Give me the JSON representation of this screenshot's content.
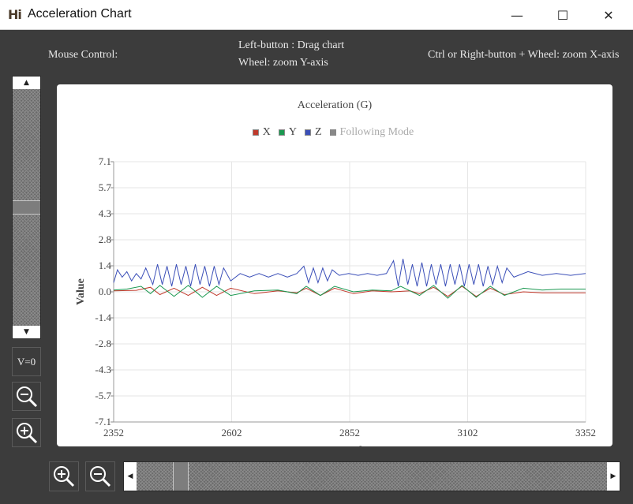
{
  "window": {
    "logo": "Hi",
    "title": "Acceleration Chart",
    "min_glyph": "—",
    "max_glyph": "☐",
    "close_glyph": "✕"
  },
  "mouse_control": {
    "label": "Mouse Control:",
    "left_button": "Left-button : Drag chart",
    "wheel": "Wheel: zoom Y-axis",
    "ctrl_wheel": "Ctrl or Right-button + Wheel: zoom X-axis"
  },
  "controls": {
    "v0_label": "V=0",
    "zoom_out_icon": "zoom-out-icon",
    "zoom_in_icon": "zoom-in-icon",
    "up_arrow": "▲",
    "down_arrow": "▼",
    "left_arrow": "◀",
    "right_arrow": "▶",
    "v_scroll_position": 0.5,
    "h_scroll_position": 0.08
  },
  "legend": [
    {
      "label": "X",
      "color": "#c0392b"
    },
    {
      "label": "Y",
      "color": "#1a9850"
    },
    {
      "label": "Z",
      "color": "#3b4fb8"
    },
    {
      "label": "Following Mode",
      "color": "#888888",
      "muted": true
    }
  ],
  "chart_data": {
    "type": "line",
    "title": "Acceleration (G)",
    "xlabel": "Sample",
    "ylabel": "Value",
    "xlim": [
      2352,
      3352
    ],
    "ylim": [
      -7.1,
      7.1
    ],
    "x_ticks": [
      "2352",
      "2602",
      "2852",
      "3102",
      "3352"
    ],
    "y_ticks": [
      "7.1",
      "5.7",
      "4.3",
      "2.8",
      "1.4",
      "0.0",
      "-1.4",
      "-2.8",
      "-4.3",
      "-5.7",
      "-7.1"
    ],
    "grid": true,
    "series": [
      {
        "name": "X",
        "color": "#c0392b",
        "x": [
          2352,
          2400,
          2430,
          2450,
          2480,
          2510,
          2540,
          2570,
          2600,
          2650,
          2700,
          2740,
          2760,
          2790,
          2820,
          2860,
          2900,
          2940,
          2980,
          3000,
          3030,
          3060,
          3090,
          3120,
          3150,
          3180,
          3220,
          3260,
          3300,
          3352
        ],
        "y": [
          0.05,
          0.08,
          0.25,
          -0.15,
          0.2,
          -0.2,
          0.25,
          -0.2,
          0.2,
          -0.1,
          0.05,
          -0.05,
          0.2,
          -0.2,
          0.2,
          -0.1,
          0.05,
          0.0,
          0.05,
          -0.1,
          0.25,
          -0.25,
          0.3,
          -0.25,
          0.2,
          -0.15,
          0.0,
          -0.05,
          -0.05,
          -0.05
        ]
      },
      {
        "name": "Y",
        "color": "#1a9850",
        "x": [
          2352,
          2380,
          2410,
          2430,
          2450,
          2480,
          2510,
          2540,
          2570,
          2600,
          2650,
          2700,
          2740,
          2760,
          2790,
          2820,
          2860,
          2900,
          2940,
          2960,
          3000,
          3030,
          3060,
          3090,
          3120,
          3150,
          3180,
          3220,
          3260,
          3300,
          3352
        ],
        "y": [
          0.1,
          0.15,
          0.3,
          -0.1,
          0.35,
          -0.25,
          0.35,
          -0.3,
          0.3,
          -0.2,
          0.05,
          0.1,
          -0.1,
          0.3,
          -0.2,
          0.3,
          0.0,
          0.1,
          0.05,
          0.3,
          -0.2,
          0.35,
          -0.35,
          0.35,
          -0.3,
          0.3,
          -0.2,
          0.2,
          0.1,
          0.15,
          0.15
        ]
      },
      {
        "name": "Z",
        "color": "#3b4fb8",
        "x": [
          2352,
          2360,
          2370,
          2380,
          2390,
          2400,
          2410,
          2420,
          2435,
          2445,
          2455,
          2465,
          2475,
          2485,
          2495,
          2505,
          2515,
          2525,
          2535,
          2545,
          2555,
          2565,
          2575,
          2585,
          2600,
          2620,
          2640,
          2660,
          2680,
          2700,
          2720,
          2740,
          2755,
          2765,
          2775,
          2785,
          2795,
          2805,
          2815,
          2830,
          2850,
          2870,
          2890,
          2910,
          2930,
          2945,
          2955,
          2965,
          2975,
          2985,
          2995,
          3005,
          3015,
          3025,
          3035,
          3045,
          3055,
          3065,
          3075,
          3085,
          3095,
          3105,
          3115,
          3125,
          3135,
          3145,
          3155,
          3165,
          3175,
          3185,
          3200,
          3230,
          3260,
          3290,
          3320,
          3352
        ],
        "y": [
          0.5,
          1.2,
          0.8,
          1.1,
          0.6,
          1.0,
          0.7,
          1.3,
          0.4,
          1.5,
          0.4,
          1.4,
          0.3,
          1.5,
          0.4,
          1.4,
          0.3,
          1.5,
          0.4,
          1.4,
          0.3,
          1.4,
          0.4,
          1.3,
          0.6,
          1.0,
          0.8,
          1.0,
          0.8,
          1.0,
          0.8,
          1.0,
          1.4,
          0.5,
          1.3,
          0.5,
          1.3,
          0.6,
          1.2,
          0.9,
          1.0,
          0.9,
          1.0,
          0.9,
          1.0,
          1.7,
          0.3,
          1.8,
          0.4,
          1.5,
          0.3,
          1.6,
          0.3,
          1.5,
          0.4,
          1.5,
          0.3,
          1.5,
          0.4,
          1.5,
          0.3,
          1.5,
          0.4,
          1.5,
          0.3,
          1.4,
          0.4,
          1.4,
          0.5,
          1.3,
          0.8,
          1.1,
          0.9,
          1.0,
          0.9,
          1.0
        ]
      }
    ]
  }
}
